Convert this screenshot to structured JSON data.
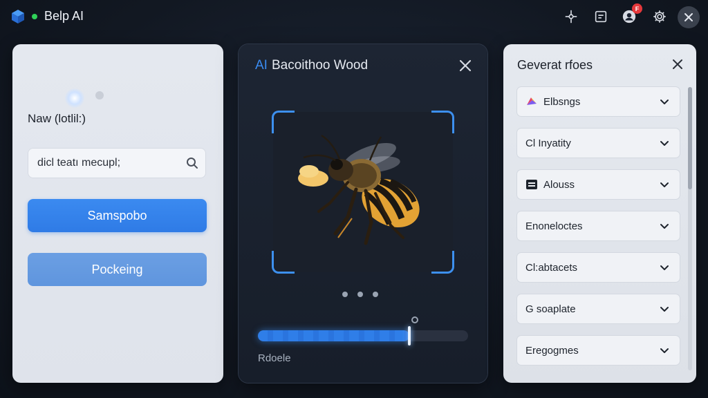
{
  "app": {
    "title": "Belp AI",
    "logo_icon": "layers-cube-icon",
    "status_color": "#2fd158"
  },
  "toolbar": {
    "icons": [
      "network-icon",
      "note-icon",
      "user-icon",
      "gear-icon",
      "close-icon"
    ],
    "notification_badge": "F"
  },
  "left_panel": {
    "title": "Naw (lotlil:)",
    "search": {
      "value": "dicl teatı mecupl;",
      "icon": "search-icon"
    },
    "primary_button": "Samspobo",
    "secondary_button": "Pockeing"
  },
  "center_panel": {
    "title_prefix": "AI",
    "title": "Bacoithoo Wood",
    "image_subject": "honeybee",
    "carousel_dots": 3,
    "progress": 0.72,
    "footer": "Rdoele",
    "accent": "#3a8cf2"
  },
  "right_panel": {
    "title": "Geverat rfoes",
    "items": [
      {
        "label": "Elbsngs",
        "icon": "palette-icon"
      },
      {
        "label": "Cl Inyatity",
        "icon": ""
      },
      {
        "label": "Alouss",
        "icon": "list-box-icon"
      },
      {
        "label": "Enoneloctes",
        "icon": ""
      },
      {
        "label": "Cl:abtacets",
        "icon": ""
      },
      {
        "label": "G soaplate",
        "icon": ""
      },
      {
        "label": "Eregogmes",
        "icon": ""
      }
    ]
  }
}
